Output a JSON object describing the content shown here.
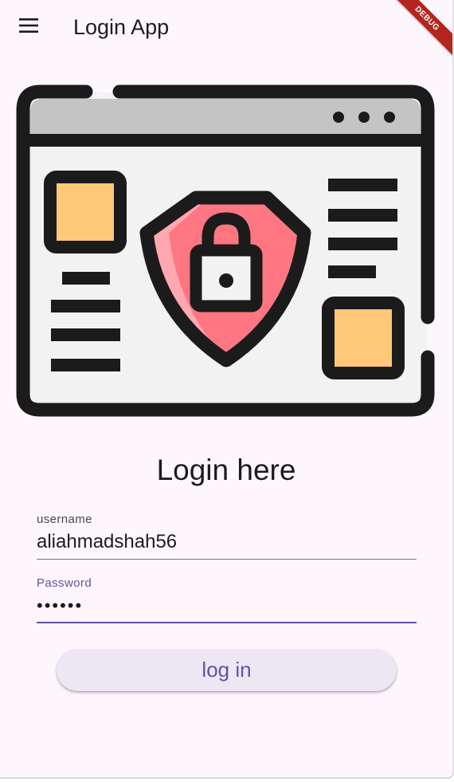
{
  "app_bar": {
    "title": "Login App",
    "menu_icon": "menu-icon"
  },
  "debug_banner": {
    "label": "DEBUG",
    "color": "#b3261e"
  },
  "illustration": {
    "icon": "browser-security-shield-lock-icon",
    "colors": {
      "outline": "#1b1b1b",
      "window": "#f2f2f2",
      "title_bar": "#c4c4c4",
      "shield": "#ff7683",
      "shield_highlight": "#ffa8b1",
      "accent_square": "#ffc878"
    }
  },
  "heading": "Login here",
  "form": {
    "username": {
      "label": "username",
      "value": "aliahmadshah56"
    },
    "password": {
      "label": "Password",
      "value": "••••••"
    }
  },
  "login_button": {
    "label": "log in"
  },
  "colors": {
    "background": "#fdf7fd",
    "primary": "#6750a4",
    "button_bg": "#ede7f3",
    "text": "#1d1b20"
  }
}
